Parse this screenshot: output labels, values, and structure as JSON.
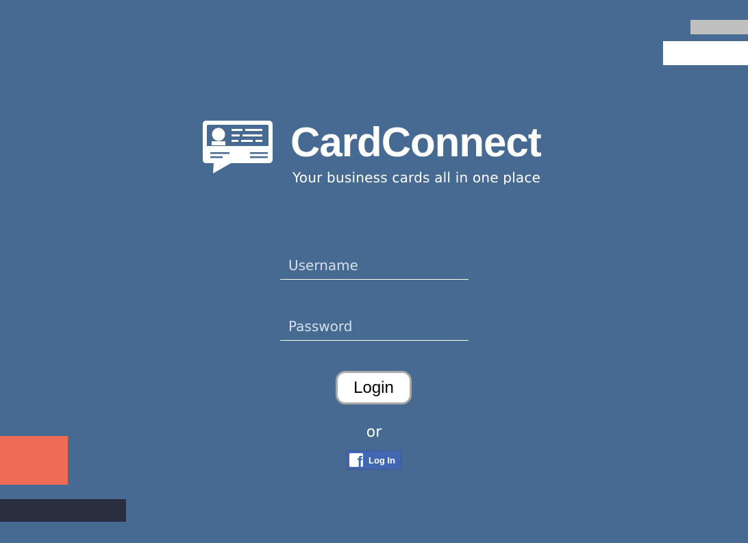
{
  "brand": {
    "name": "CardConnect",
    "tagline": "Your business cards all in one place"
  },
  "login_form": {
    "username_placeholder": "Username",
    "password_placeholder": "Password",
    "login_label": "Login",
    "separator": "or",
    "facebook_label": "Log In"
  },
  "colors": {
    "background": "#476a92",
    "accent_coral": "#f06c55",
    "accent_navy": "#2a2d3e",
    "facebook_blue": "#4267b2"
  },
  "icons": {
    "logo": "business-card-chat-icon",
    "facebook": "facebook-f-icon"
  }
}
